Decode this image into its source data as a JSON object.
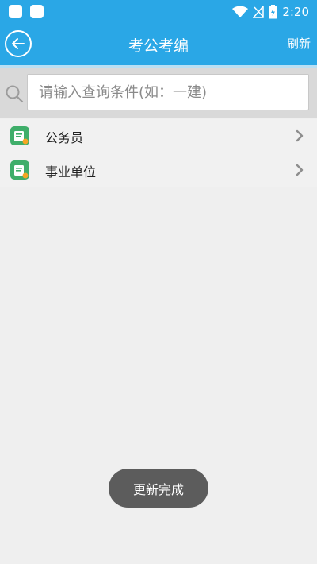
{
  "status_bar": {
    "time": "2:20"
  },
  "app_bar": {
    "title": "考公考编",
    "refresh_label": "刷新"
  },
  "search": {
    "placeholder": "请输入查询条件(如：一建)",
    "value": ""
  },
  "list": {
    "items": [
      {
        "label": "公务员",
        "icon": "app-logo-icon"
      },
      {
        "label": "事业单位",
        "icon": "app-logo-icon"
      }
    ]
  },
  "toast": {
    "message": "更新完成"
  },
  "colors": {
    "accent": "#2aa7e6",
    "background": "#efefef",
    "toast": "#5c5c5c"
  }
}
